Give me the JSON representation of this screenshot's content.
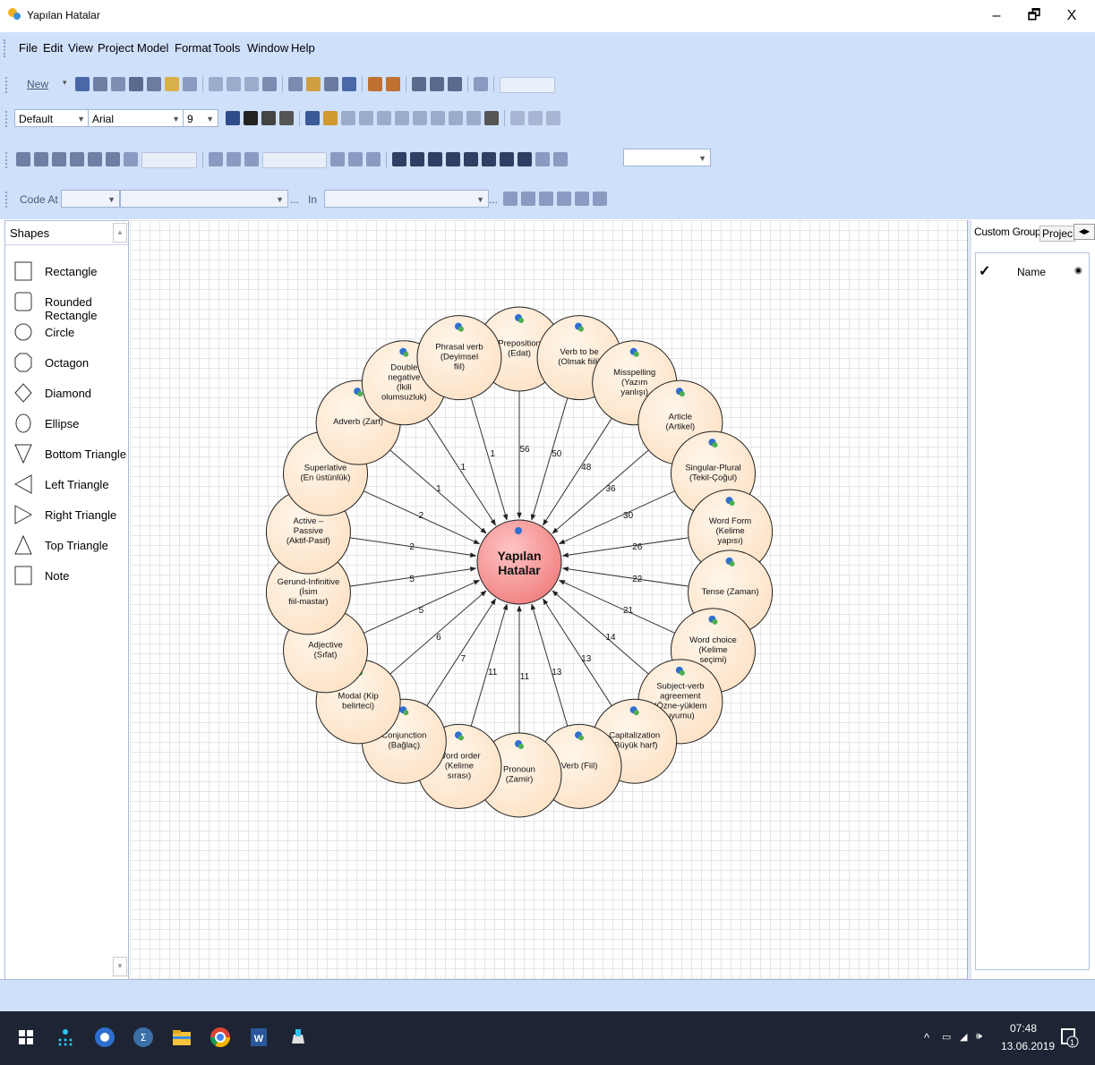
{
  "window": {
    "title": "Yapılan Hatalar",
    "minimize": "–",
    "restore": "🗗",
    "close": "X"
  },
  "menu": [
    "File",
    "Edit",
    "View",
    "Project",
    "Model",
    "Format",
    "Tools",
    "Window",
    "Help"
  ],
  "toolbar": {
    "new_label": "New",
    "style_value": "Default",
    "font_value": "Arial",
    "size_value": "9",
    "code_at_label": "Code At",
    "in_label": "In",
    "ellipsis": "..."
  },
  "shapes_panel": {
    "title": "Shapes",
    "items": [
      "Rectangle",
      "Rounded Rectangle",
      "Circle",
      "Octagon",
      "Diamond",
      "Ellipse",
      "Bottom Triangle",
      "Left Triangle",
      "Right Triangle",
      "Top Triangle",
      "Note"
    ]
  },
  "right_panel": {
    "tab_custom_groups": "Custom Groups",
    "tab_project": "Projec",
    "column_check": "✓",
    "column_name": "Name"
  },
  "diagram": {
    "center": "Yapılan Hatalar",
    "nodes": [
      {
        "label": "Preposition (Edat)",
        "count": "56"
      },
      {
        "label": "Verb to be (Olmak fiili)",
        "count": "50"
      },
      {
        "label": "Misspelling (Yazım yanlışı)",
        "count": "48"
      },
      {
        "label": "Article (Artikel)",
        "count": "36"
      },
      {
        "label": "Singular-Plural (Tekil-Çoğul)",
        "count": "30"
      },
      {
        "label": "Word Form (Kelime yapısı)",
        "count": "26"
      },
      {
        "label": "Tense (Zaman)",
        "count": "22"
      },
      {
        "label": "Word choice (Kelime seçimi)",
        "count": "21"
      },
      {
        "label": "Subject-verb agreement (Özne-yüklem uyumu)",
        "count": "14"
      },
      {
        "label": "Capitalization (Büyük harf)",
        "count": "13"
      },
      {
        "label": "Verb (Fiil)",
        "count": "13"
      },
      {
        "label": "Pronoun (Zamir)",
        "count": "11"
      },
      {
        "label": "Word order (Kelime sırası)",
        "count": "11"
      },
      {
        "label": "Conjunction (Bağlaç)",
        "count": "7"
      },
      {
        "label": "Modal (Kip belirteci)",
        "count": "6"
      },
      {
        "label": "Adjective (Sıfat)",
        "count": "5"
      },
      {
        "label": "Gerund-Infinitive (İsim fiil-mastar)",
        "count": "5"
      },
      {
        "label": "Active – Passive (Aktif-Pasif)",
        "count": "2"
      },
      {
        "label": "Superlative (En üstünlük)",
        "count": "2"
      },
      {
        "label": "Adverb (Zarf)",
        "count": "1"
      },
      {
        "label": "Double negative (İkili olumsuzluk)",
        "count": "1"
      },
      {
        "label": "Phrasal verb (Deyimsel fiil)",
        "count": "1"
      }
    ]
  },
  "taskbar": {
    "time": "07:48",
    "date": "13.06.2019",
    "notification_count": "1"
  },
  "colors": {
    "toolbar_bg": "#cfe0fb",
    "node_fill": "#fde2c6",
    "center_fill": "#f08080",
    "taskbar_bg": "#1d2433"
  }
}
